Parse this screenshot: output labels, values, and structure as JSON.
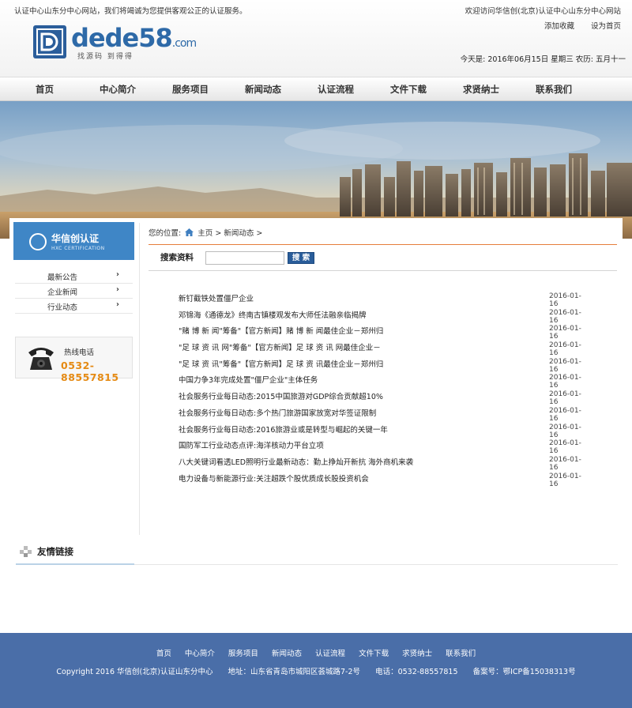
{
  "header": {
    "welcome_left": "认证中心山东分中心网站，我们将竭诚为您提供客观公正的认证服务。",
    "welcome_right": "欢迎访问华信创(北京)认证中心山东分中心网站",
    "links": [
      "添加收藏",
      "设为首页"
    ],
    "date_line": "今天是: 2016年06月15日 星期三 农历: 五月十一",
    "logo_text": "dede58",
    "logo_domain": ".com",
    "logo_sub": "找源码 到得得"
  },
  "nav": {
    "items": [
      "首页",
      "中心简介",
      "服务项目",
      "新闻动态",
      "认证流程",
      "文件下载",
      "求贤纳士",
      "联系我们"
    ]
  },
  "sidebar": {
    "brand_title": "华信创认证",
    "brand_sub": "HXC CERTIFICATION",
    "items": [
      {
        "label": "最新公告",
        "arrow": "›"
      },
      {
        "label": "企业新闻",
        "arrow": "›"
      },
      {
        "label": "行业动态",
        "arrow": "›"
      }
    ],
    "hotline_label": "热线电话",
    "hotline_number": "0532-88557815"
  },
  "breadcrumb": {
    "prefix": "您的位置:",
    "home": "主页",
    "sep1": ">",
    "current": "新闻动态",
    "sep2": ">"
  },
  "search": {
    "label": "搜索资料",
    "value": "",
    "button": "搜 索"
  },
  "news": [
    {
      "title": "新钉截铁处置僵尸企业",
      "date": "2016-01-16"
    },
    {
      "title": "邓锦海《通德龙》终南古镇楼观发布大师任法融亲临揭牌",
      "date": "2016-01-16"
    },
    {
      "title": "\"赌 博 新 闻\"筹备\"【官方新闻】赌 博 新 闻最佳企业－郑州归",
      "date": "2016-01-16"
    },
    {
      "title": "\"足 球 资 讯 网\"筹备\"【官方新闻】足 球 资 讯 网最佳企业－",
      "date": "2016-01-16"
    },
    {
      "title": "\"足 球 资 讯\"筹备\"【官方新闻】足 球 资 讯最佳企业－郑州归",
      "date": "2016-01-16"
    },
    {
      "title": "中国力争3年完成处置\"僵尸企业\"主体任务",
      "date": "2016-01-16"
    },
    {
      "title": "社会服务行业每日动态:2015中国旅游对GDP综合贡献超10%",
      "date": "2016-01-16"
    },
    {
      "title": "社会服务行业每日动态:多个热门旅游国家放宽对华签证限制",
      "date": "2016-01-16"
    },
    {
      "title": "社会服务行业每日动态:2016旅游业或是转型与崛起的关键一年",
      "date": "2016-01-16"
    },
    {
      "title": "国防军工行业动态点评:海洋核动力平台立项",
      "date": "2016-01-16"
    },
    {
      "title": "八大关键词看透LED照明行业最新动态：勤上挣灿开新抗 海外商机来袭",
      "date": "2016-01-16"
    },
    {
      "title": "电力设备与新能源行业:关注超跌个股优质成长股投资机会",
      "date": "2016-01-16"
    }
  ],
  "friend_links": {
    "title": "友情链接"
  },
  "footer": {
    "nav": [
      "首页",
      "中心简介",
      "服务项目",
      "新闻动态",
      "认证流程",
      "文件下载",
      "求贤纳士",
      "联系我们"
    ],
    "copyright": "Copyright 2016 华信创(北京)认证山东分中心",
    "address": "地址：山东省青岛市城阳区荟城路7-2号",
    "phone": "电话：0532-88557815",
    "icp": "备案号：鄂ICP备15038313号"
  },
  "colors": {
    "nav_bg": "#e6e6e6",
    "sidebar_accent": "#3f86c6",
    "hotline_number": "#e58a13",
    "breadcrumb_rule": "#e67e3c",
    "search_button": "#2a5d9a",
    "footer_bg": "#4a6ea8"
  }
}
